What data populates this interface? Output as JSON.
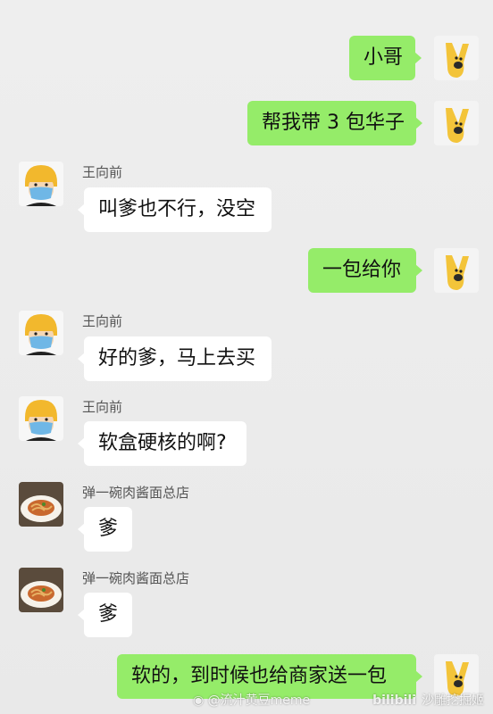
{
  "messages": [
    {
      "direction": "out",
      "text": "小哥"
    },
    {
      "direction": "out",
      "text": "帮我带 3 包华子"
    },
    {
      "direction": "in",
      "sender": "王向前",
      "text": "叫爹也不行，没空"
    },
    {
      "direction": "out",
      "text": "一包给你"
    },
    {
      "direction": "in",
      "sender": "王向前",
      "text": "好的爹，马上去买"
    },
    {
      "direction": "in",
      "sender": "王向前",
      "text": "软盒硬核的啊?"
    },
    {
      "direction": "in",
      "sender": "弹一碗肉酱面总店",
      "text": "爹"
    },
    {
      "direction": "in",
      "sender": "弹一碗肉酱面总店",
      "text": "爹"
    },
    {
      "direction": "out",
      "text": "软的，到时候也给商家送一包"
    }
  ],
  "watermarks": {
    "weibo": "@流汁黄豆meme",
    "bilibili": "bilibili",
    "bilibili_user": "沙雕挖掘姬"
  },
  "colors": {
    "outgoing_bubble": "#95ec69",
    "incoming_bubble": "#ffffff",
    "background": "#ededed"
  }
}
